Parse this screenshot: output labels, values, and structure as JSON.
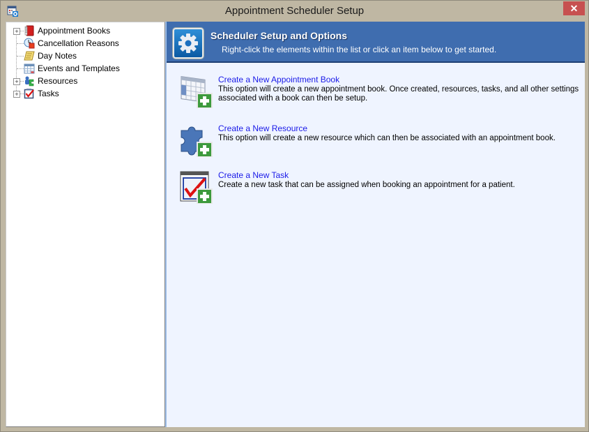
{
  "window": {
    "title": "Appointment Scheduler Setup",
    "app_icon": "calendar-gear-icon",
    "close_glyph": "✕"
  },
  "tree": {
    "items": [
      {
        "label": "Appointment Books",
        "icon": "red-book-icon",
        "expandable": true,
        "expander": "+"
      },
      {
        "label": "Cancellation Reasons",
        "icon": "cancel-clock-icon",
        "expandable": false
      },
      {
        "label": "Day Notes",
        "icon": "notepad-icon",
        "expandable": false
      },
      {
        "label": "Events and Templates",
        "icon": "calendar-grid-icon",
        "expandable": false
      },
      {
        "label": "Resources",
        "icon": "puzzle-people-icon",
        "expandable": true,
        "expander": "+"
      },
      {
        "label": "Tasks",
        "icon": "checkbox-task-icon",
        "expandable": true,
        "expander": "+"
      }
    ]
  },
  "header": {
    "title": "Scheduler Setup and Options",
    "subtitle": "Right-click the elements within the list or click an item below to get started.",
    "icon": "gear-icon",
    "band_color": "#3f6daf"
  },
  "options": [
    {
      "link": "Create a New Appointment Book",
      "description": "This option will create a new appointment book.  Once created, resources, tasks, and all other settings associated with a book can then be setup.",
      "icon": "new-appointment-book-icon"
    },
    {
      "link": "Create a New Resource",
      "description": "This option will create a new resource which can then be associated with an appointment book.",
      "icon": "new-resource-icon"
    },
    {
      "link": "Create a New Task",
      "description": "Create a new task that can be assigned when booking an appointment for a patient.",
      "icon": "new-task-icon"
    }
  ],
  "colors": {
    "link": "#1a1ae8",
    "content_bg": "#eff4ff",
    "close_button": "#c75050",
    "frame": "#bfb7a3"
  }
}
